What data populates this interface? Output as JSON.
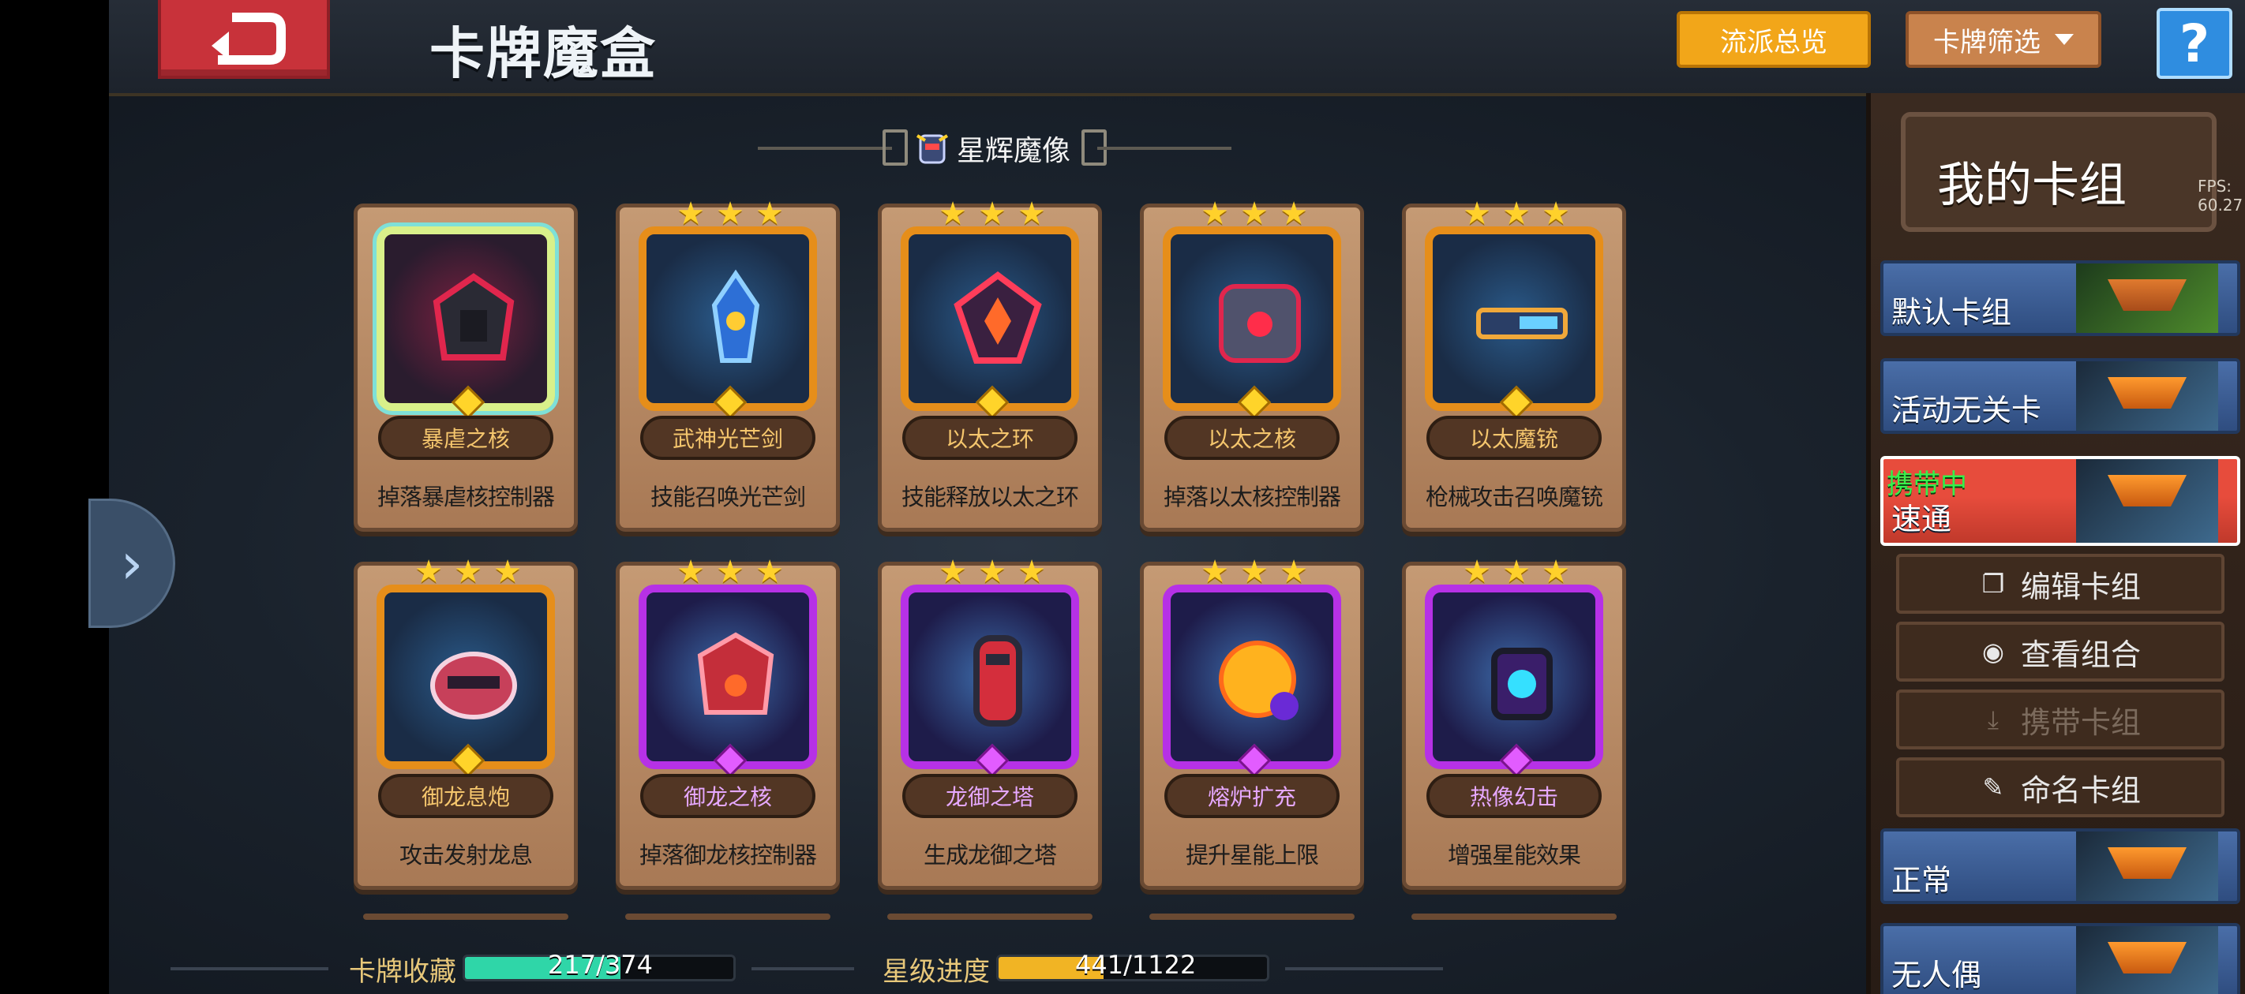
{
  "header": {
    "title": "卡牌魔盒",
    "overview_button": "流派总览",
    "filter_button": "卡牌筛选",
    "help_button": "?"
  },
  "section": {
    "label": "星辉魔像"
  },
  "cards": [
    {
      "name": "暴虐之核",
      "desc": "掉落暴虐核控制器",
      "rarity": "legendary",
      "stars": 0
    },
    {
      "name": "武神光芒剑",
      "desc": "技能召唤光芒剑",
      "rarity": "orange",
      "stars": 3
    },
    {
      "name": "以太之环",
      "desc": "技能释放以太之环",
      "rarity": "orange",
      "stars": 3
    },
    {
      "name": "以太之核",
      "desc": "掉落以太核控制器",
      "rarity": "orange",
      "stars": 3
    },
    {
      "name": "以太魔铳",
      "desc": "枪械攻击召唤魔铳",
      "rarity": "orange",
      "stars": 3
    },
    {
      "name": "御龙息炮",
      "desc": "攻击发射龙息",
      "rarity": "orange",
      "stars": 3
    },
    {
      "name": "御龙之核",
      "desc": "掉落御龙核控制器",
      "rarity": "purple",
      "stars": 3
    },
    {
      "name": "龙御之塔",
      "desc": "生成龙御之塔",
      "rarity": "purple",
      "stars": 3
    },
    {
      "name": "熔炉扩充",
      "desc": "提升星能上限",
      "rarity": "purple",
      "stars": 3
    },
    {
      "name": "热像幻击",
      "desc": "增强星能效果",
      "rarity": "purple",
      "stars": 3
    }
  ],
  "bottom": {
    "collection_label": "卡牌收藏",
    "collection_value": "217/374",
    "collection_fraction": 0.58,
    "star_label": "星级进度",
    "star_value": "441/1122",
    "star_fraction": 0.39
  },
  "right_panel": {
    "title": "我的卡组",
    "fps": "FPS: 60.27",
    "decks": [
      {
        "name": "默认卡组",
        "active": false
      },
      {
        "name": "活动无关卡",
        "active": false
      },
      {
        "name": "速通",
        "active": true,
        "tag": "携带中"
      },
      {
        "name": "正常",
        "active": false
      },
      {
        "name": "无人偶",
        "active": false
      }
    ],
    "actions": {
      "edit": "编辑卡组",
      "view": "查看组合",
      "carry": "携带卡组",
      "rename": "命名卡组"
    }
  },
  "colors": {
    "collection_fill": "#2fd6a8",
    "star_fill": "#f1b424",
    "overview_btn": "#f2a619",
    "active_deck": "#e74c3c"
  },
  "icons": {
    "back": "back-arrow-icon",
    "chevron": "chevron-right-icon",
    "dropdown": "caret-down-icon",
    "edit": "cards-icon",
    "view": "eye-icon",
    "carry": "download-icon",
    "rename": "pencil-icon"
  }
}
